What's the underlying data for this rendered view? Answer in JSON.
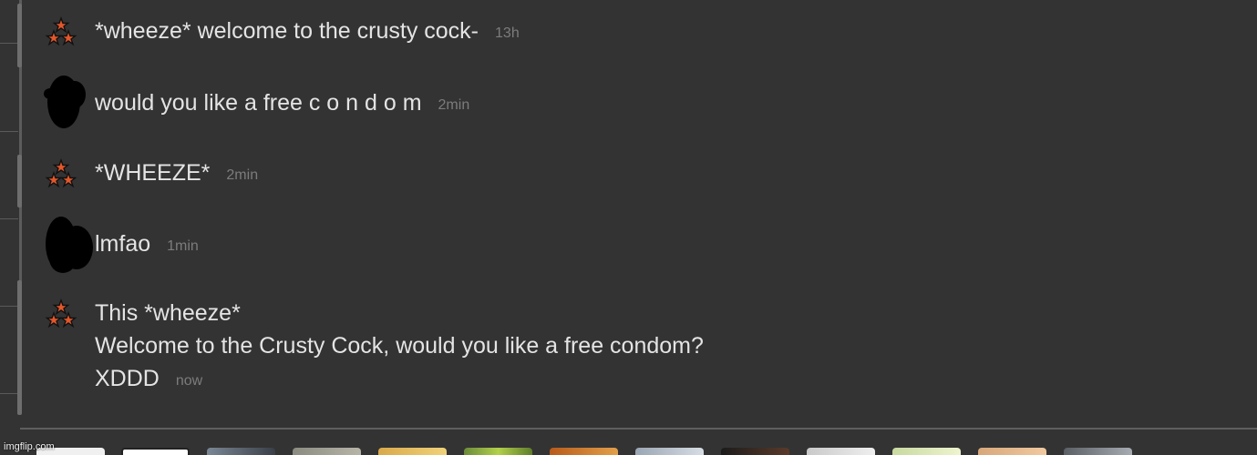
{
  "thread": {
    "messages": [
      {
        "author": "star-user",
        "lines": [
          "*wheeze* welcome to the crusty cock-"
        ],
        "time": "13h"
      },
      {
        "author": "redacted-user",
        "lines": [
          "would you like a free c o n d o m"
        ],
        "time": "2min"
      },
      {
        "author": "star-user",
        "lines": [
          "*WHEEZE*"
        ],
        "time": "2min"
      },
      {
        "author": "redacted-user",
        "lines": [
          "lmfao"
        ],
        "time": "1min"
      },
      {
        "author": "star-user",
        "lines": [
          "This *wheeze*",
          "Welcome to the Crusty Cock, would you like a free condom?",
          "XDDD"
        ],
        "time": "now"
      }
    ]
  },
  "avatar_icons": {
    "star_user": "three-stars-icon",
    "redacted_user": "redacted-avatar"
  },
  "colors": {
    "background": "#333333",
    "text": "#e4e4e4",
    "timestamp": "#7c7c7c",
    "star_orange": "#e2572b",
    "redaction": "#000000"
  },
  "watermark": "imgflip.com"
}
